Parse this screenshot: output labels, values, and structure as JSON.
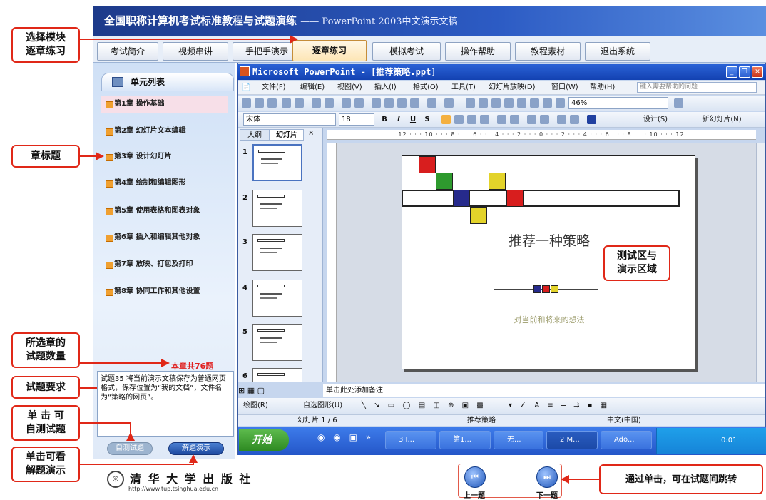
{
  "app": {
    "title": "全国职称计算机考试标准教程与试题演练",
    "subtitle": "—— PowerPoint 2003中文演示文稿"
  },
  "nav": {
    "tabs": [
      {
        "label": "考试简介"
      },
      {
        "label": "视频串讲"
      },
      {
        "label": "手把手演示"
      },
      {
        "label": "逐章练习"
      },
      {
        "label": "模拟考试"
      },
      {
        "label": "操作帮助"
      },
      {
        "label": "教程素材"
      },
      {
        "label": "退出系统"
      }
    ],
    "active": "逐章练习"
  },
  "sidebar": {
    "header": "单元列表",
    "chapters": [
      {
        "label": "第1章 操作基础"
      },
      {
        "label": "第2章 幻灯片文本编辑"
      },
      {
        "label": "第3章 设计幻灯片"
      },
      {
        "label": "第4章 绘制和编辑图形"
      },
      {
        "label": "第5章 使用表格和图表对象"
      },
      {
        "label": "第6章 插入和编辑其他对象"
      },
      {
        "label": "第7章 放映、打包及打印"
      },
      {
        "label": "第8章 协同工作和其他设置"
      }
    ],
    "count_text": "本章共76题",
    "question_text": "试题35 将当前演示文稿保存为普通网页格式，保存位置为“我的文档”，文件名为“策略的网页”。",
    "self_test_label": "自测试题",
    "demo_label": "解题演示"
  },
  "ppt": {
    "title": "Microsoft PowerPoint - [推荐策略.ppt]",
    "menus": [
      "文件(F)",
      "编辑(E)",
      "视图(V)",
      "插入(I)",
      "格式(O)",
      "工具(T)",
      "幻灯片放映(D)",
      "窗口(W)",
      "帮助(H)"
    ],
    "help_placeholder": "键入需要帮助的问题",
    "zoom": "46%",
    "font": "宋体",
    "font_size": "18",
    "format_buttons": [
      "B",
      "I",
      "U",
      "S"
    ],
    "design_label": "设计(S)",
    "new_slide_label": "新幻灯片(N)",
    "panel_tabs": [
      "大纲",
      "幻灯片"
    ],
    "slide_numbers": [
      "1",
      "2",
      "3",
      "4",
      "5",
      "6"
    ],
    "ruler_text": "12 · · · 10 · · · 8 · · · 6 · · · 4 · · · 2 · · · 0 · · · 2 · · · 4 · · · 6 · · · 8 · · · 10 · · · 12",
    "slide": {
      "title": "推荐一种策略",
      "subtitle": "对当前和将来的想法"
    },
    "notes_placeholder": "单击此处添加备注",
    "draw_label": "绘图(R)",
    "autoshape_label": "自选图形(U)",
    "status": {
      "slide_pos": "幻灯片 1 / 6",
      "design": "推荐策略",
      "language": "中文(中国)"
    },
    "taskbar": {
      "start": "开始",
      "items": [
        {
          "label": "3 I..."
        },
        {
          "label": "第1..."
        },
        {
          "label": "无..."
        },
        {
          "label": "2 M..."
        },
        {
          "label": "Ado..."
        }
      ],
      "clock": "0:01"
    },
    "colors": {
      "red": "#d81e1e",
      "green": "#2e9a2e",
      "navy": "#262a8c",
      "yellow": "#e3d32a"
    }
  },
  "publisher": {
    "name": "清 华 大 学 出 版 社",
    "url": "http://www.tup.tsinghua.edu.cn"
  },
  "bottom_nav": {
    "prev_label": "上一题",
    "next_label": "下一题"
  },
  "annotations": {
    "select_module": "选择模块\n逐章练习",
    "chapter_title": "章标题",
    "question_count": "所选章的\n试题数量",
    "question_req": "试题要求",
    "self_test": "单 击 可\n自测试题",
    "demo": "单击可看\n解题演示",
    "test_area": "测试区与\n演示区域",
    "jump": "通过单击，可在试题间跳转"
  }
}
